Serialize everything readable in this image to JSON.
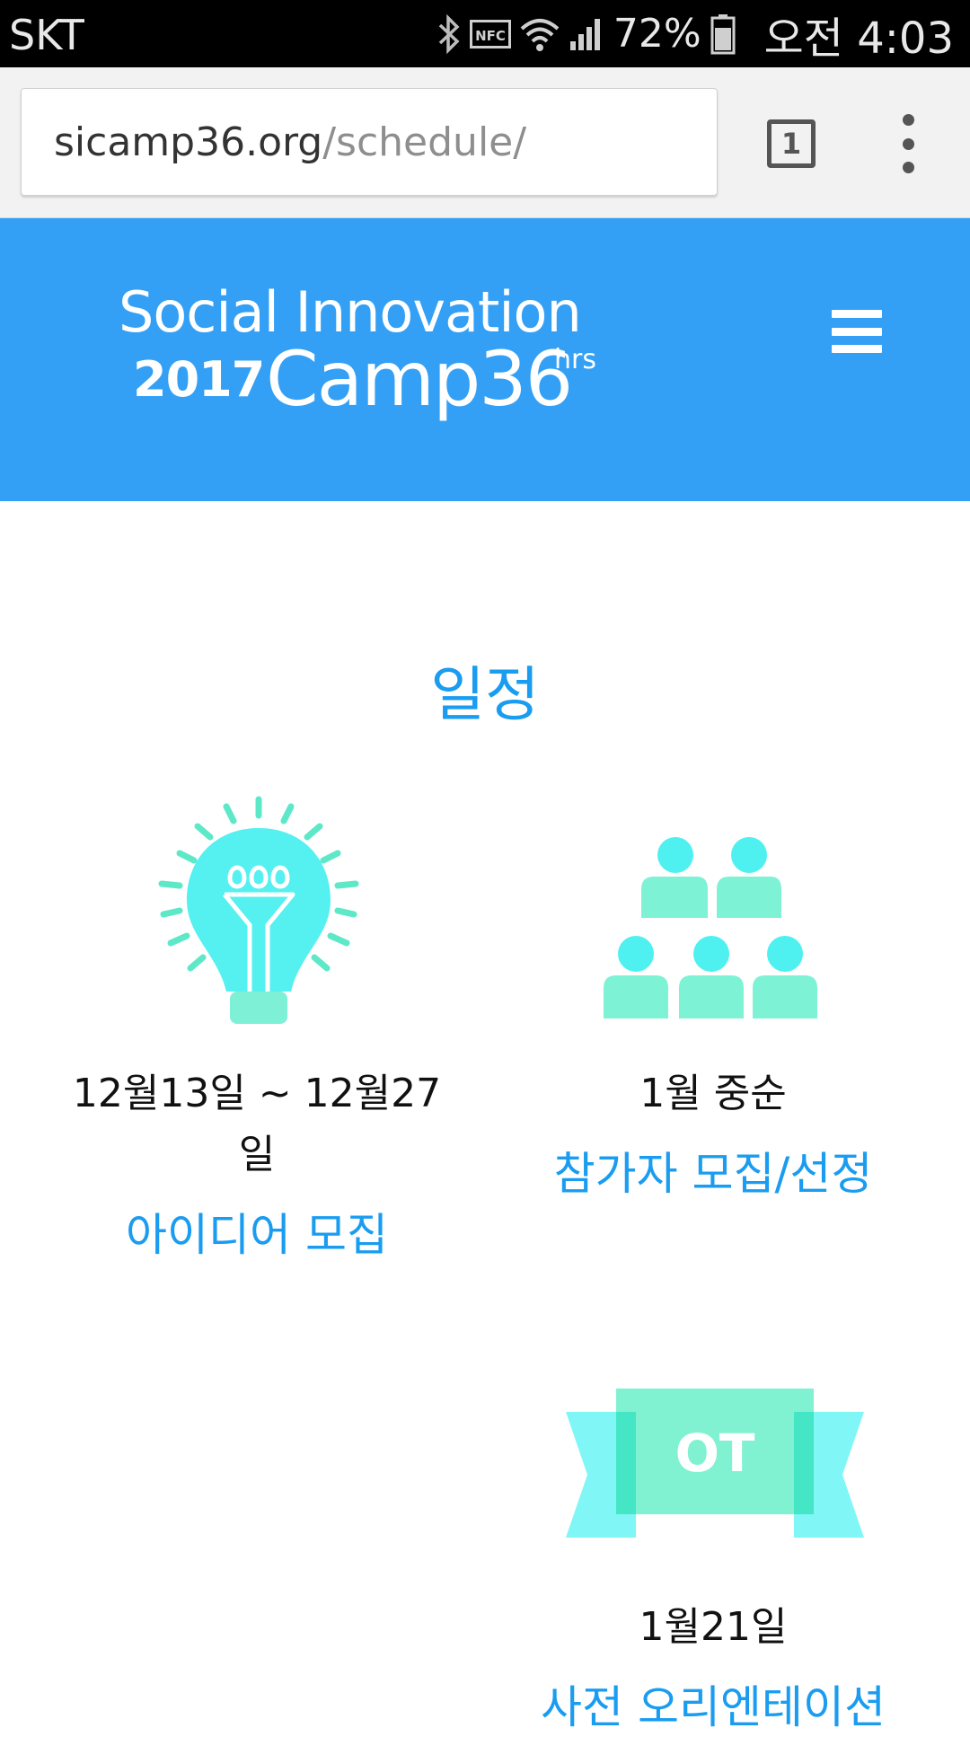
{
  "status_bar": {
    "carrier": "SKT",
    "battery_percent": "72%",
    "time": "오전 4:03",
    "icons": [
      "bluetooth-icon",
      "nfc-icon",
      "wifi-icon",
      "signal-icon",
      "battery-icon"
    ]
  },
  "browser": {
    "url_host": "sicamp36.org",
    "url_path": "/schedule/",
    "tab_count": "1"
  },
  "header": {
    "logo_line1": "Social Innovation",
    "logo_year": "2017",
    "logo_camp": "Camp36",
    "logo_hrs": "hrs",
    "background_color": "#33a0f6"
  },
  "main": {
    "title": "일정",
    "schedule": [
      {
        "icon": "lightbulb-icon",
        "date": "12월13일 ~ 12월27일",
        "label": "아이디어 모집"
      },
      {
        "icon": "people-group-icon",
        "date": "1월 중순",
        "label": "참가자 모집/선정"
      },
      {
        "icon": "ot-ribbon-icon",
        "icon_text": "OT",
        "date": "1월21일",
        "label": "사전 오리엔테이션"
      }
    ],
    "accent_color": "#1a9cf0"
  }
}
